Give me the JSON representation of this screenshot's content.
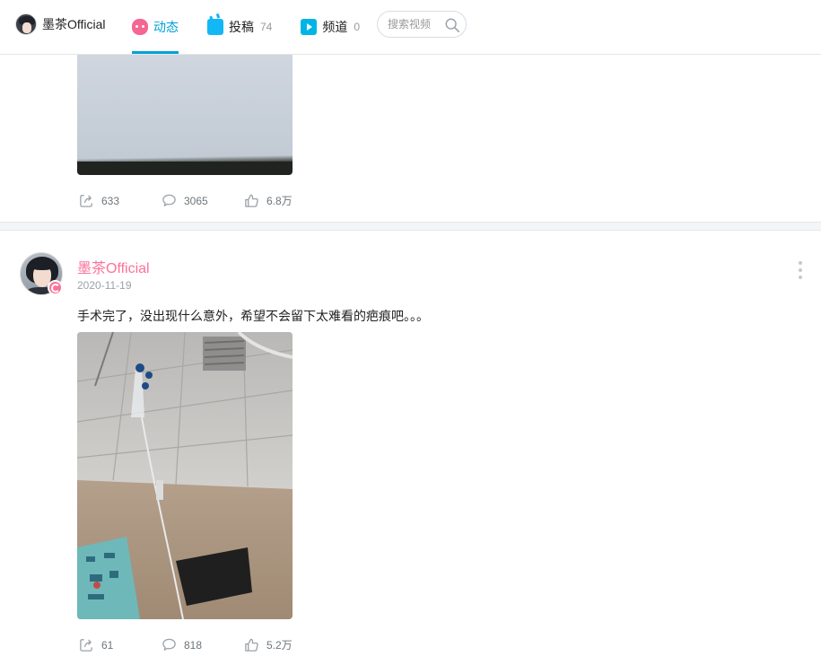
{
  "header": {
    "user_name": "墨茶Official",
    "tabs": [
      {
        "label": "动态",
        "count": ""
      },
      {
        "label": "投稿",
        "count": "74"
      },
      {
        "label": "频道",
        "count": "0"
      }
    ],
    "search_placeholder": "搜索视频"
  },
  "posts": [
    {
      "stats": {
        "share": "633",
        "comment": "3065",
        "like": "6.8万"
      }
    },
    {
      "author": "墨茶Official",
      "date": "2020-11-19",
      "text": "手术完了，没出现什么意外，希望不会留下太难看的疤痕吧。。。",
      "stats": {
        "share": "61",
        "comment": "818",
        "like": "5.2万"
      }
    }
  ],
  "colors": {
    "accent": "#00a1d6",
    "author": "#fb7299",
    "muted": "#99a2aa"
  },
  "icons": [
    "search-icon",
    "share-icon",
    "comment-icon",
    "like-icon",
    "more-icon"
  ]
}
